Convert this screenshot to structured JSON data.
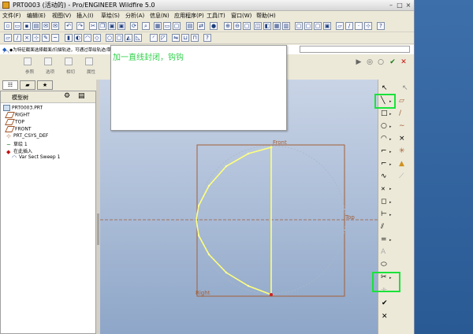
{
  "window": {
    "title": "PRT0003 (活动的) - Pro/ENGINEER Wildfire 5.0"
  },
  "menubar": {
    "items": [
      "文件(F)",
      "编辑(E)",
      "视图(V)",
      "插入(I)",
      "草绘(S)",
      "分析(A)",
      "信息(N)",
      "应用程序(P)",
      "工具(T)",
      "窗口(W)",
      "帮助(H)"
    ]
  },
  "message_bar": {
    "text": "◆为特征截面选择截面/扫描轨迹，可通过草绘轨迹/草绘/选择的轨迹来定义截面。按住 Ctrl 键可选择多条轨迹，按住 Shift 键可选取"
  },
  "dashboard": {
    "labels": [
      "参照",
      "选项",
      "相切",
      "属性"
    ]
  },
  "annotation": {
    "text": "加一直线封闭，钩钩"
  },
  "model_tree": {
    "header": "模型树",
    "items": [
      "PRT0003.PRT",
      "RIGHT",
      "TOP",
      "FRONT",
      "PRT_CSYS_DEF",
      "草绘 1",
      "在此插入",
      "Var Sect Sweep 1"
    ]
  },
  "canvas": {
    "label_front": "Front",
    "label_top": "Top",
    "label_right": "Right"
  },
  "colors": {
    "accent_green": "#19e33a",
    "annotation_green": "#2fd04a",
    "sketch_yellow": "#ffff7a",
    "datum_brown": "#a35e36"
  }
}
